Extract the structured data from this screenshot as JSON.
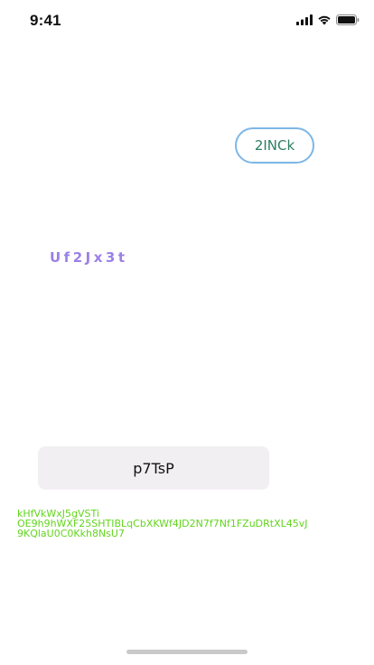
{
  "status_bar": {
    "time": "9:41",
    "icons": [
      "cellular-signal-icon",
      "wifi-icon",
      "battery-icon"
    ]
  },
  "pill_button": {
    "label": "2INCk",
    "border_color": "#7db7e6",
    "text_color": "#2e7d64"
  },
  "purple_label": {
    "text": "Uf2Jx3t",
    "color": "#9b80e8"
  },
  "grey_button": {
    "label": "p7TsP",
    "background": "#f2eff3"
  },
  "green_text": {
    "lines": [
      "kHfVkWxJ5gVSTi",
      "OE9h9hWXF25SHTIBLqCbXKWf4JD2N7f7Nf1FZuDRtXL45vJ",
      "9KQlaU0C0Kkh8NsU7"
    ],
    "color": "#62d51d"
  }
}
